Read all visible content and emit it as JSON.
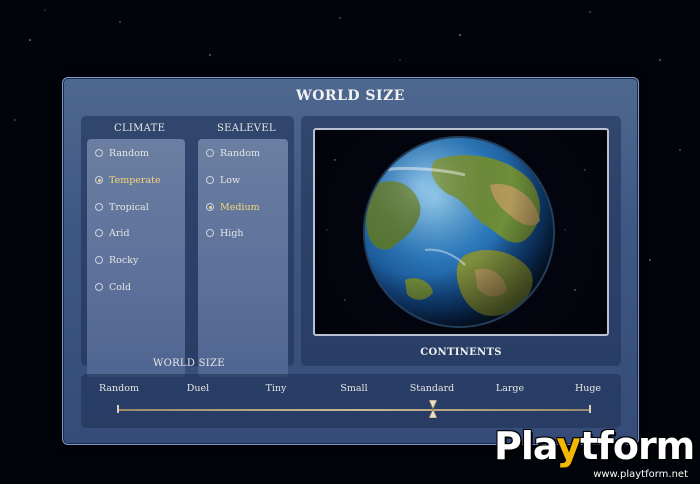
{
  "dialog": {
    "title": "WORLD SIZE"
  },
  "climate": {
    "header": "CLIMATE",
    "options": [
      {
        "label": "Random",
        "selected": false
      },
      {
        "label": "Temperate",
        "selected": true
      },
      {
        "label": "Tropical",
        "selected": false
      },
      {
        "label": "Arid",
        "selected": false
      },
      {
        "label": "Rocky",
        "selected": false
      },
      {
        "label": "Cold",
        "selected": false
      }
    ]
  },
  "sealevel": {
    "header": "SEALEVEL",
    "options": [
      {
        "label": "Random",
        "selected": false
      },
      {
        "label": "Low",
        "selected": false
      },
      {
        "label": "Medium",
        "selected": true
      },
      {
        "label": "High",
        "selected": false
      }
    ]
  },
  "preview": {
    "label": "CONTINENTS"
  },
  "world_size": {
    "header": "WORLD SIZE",
    "options": [
      "Random",
      "Duel",
      "Tiny",
      "Small",
      "Standard",
      "Large",
      "Huge"
    ],
    "selected_index": 4
  },
  "watermark": {
    "brand_pre": "Pla",
    "brand_y": "y",
    "brand_post": "tform",
    "url": "www.playtform.net"
  },
  "colors": {
    "selected_text": "#f3d47a",
    "panel": "#3f5784",
    "watermark_accent": "#f2b705"
  }
}
